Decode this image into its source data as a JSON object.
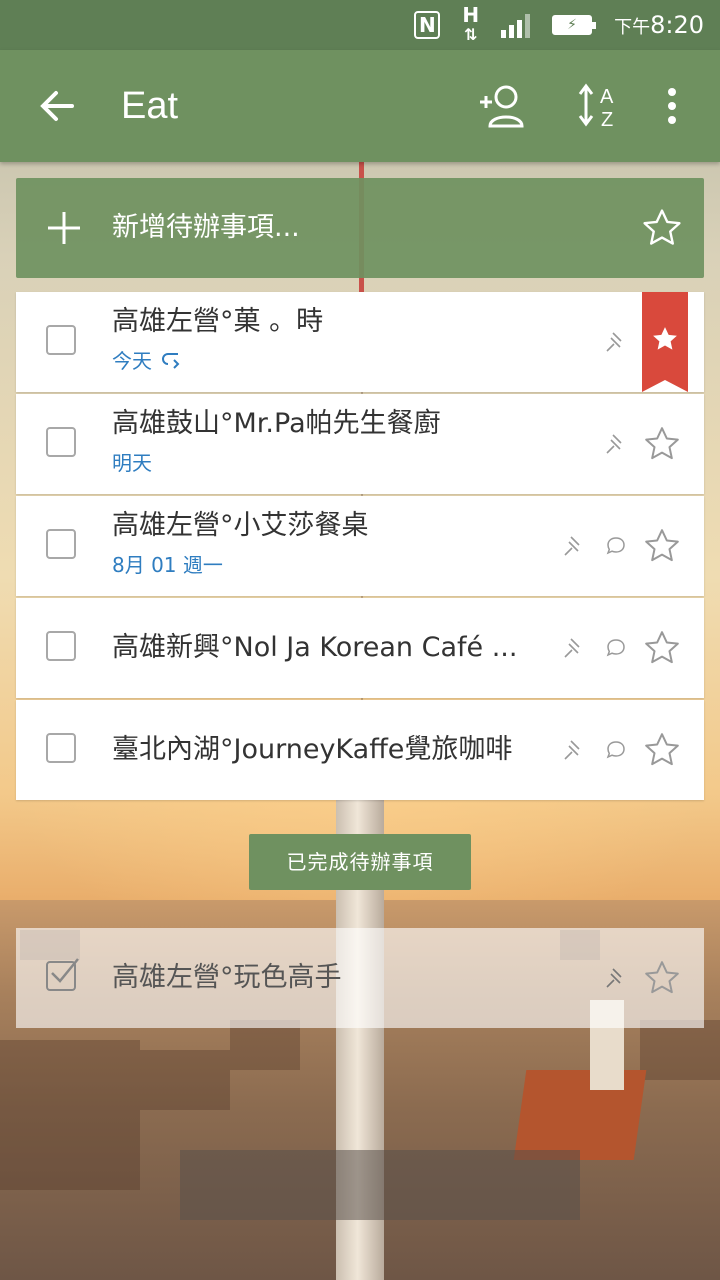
{
  "status_bar": {
    "time_prefix": "下午",
    "time": "8:20",
    "icons": [
      "nfc-icon",
      "data-h-icon",
      "signal-icon",
      "battery-charging-icon"
    ]
  },
  "app_bar": {
    "title": "Eat",
    "icons": [
      "back-arrow-icon",
      "add-member-icon",
      "sort-az-icon",
      "more-vert-icon"
    ]
  },
  "add_bar": {
    "placeholder": "新增待辦事項..."
  },
  "tasks": [
    {
      "title": "高雄左營°菓 。時",
      "due": "今天",
      "repeat": true,
      "starred": true,
      "has_comment": false
    },
    {
      "title": "高雄鼓山°Mr.Pa帕先生餐廚",
      "due": "明天",
      "repeat": false,
      "starred": false,
      "has_comment": false
    },
    {
      "title": "高雄左營°小艾莎餐桌",
      "due": "8月 01 週一",
      "repeat": false,
      "starred": false,
      "has_comment": true
    },
    {
      "title": "高雄新興°Nol Ja Korean Café ...",
      "due": "",
      "repeat": false,
      "starred": false,
      "has_comment": true
    },
    {
      "title": "臺北內湖°JourneyKaffe覺旅咖啡",
      "due": "",
      "repeat": false,
      "starred": false,
      "has_comment": true
    }
  ],
  "completed_button": "已完成待辦事項",
  "completed_tasks": [
    {
      "title": "高雄左營°玩色高手",
      "checked": true
    }
  ],
  "colors": {
    "primary": "#6f9160",
    "status_bar": "#5f7f55",
    "due_text": "#2f7dc0",
    "ribbon": "#d9493c"
  }
}
